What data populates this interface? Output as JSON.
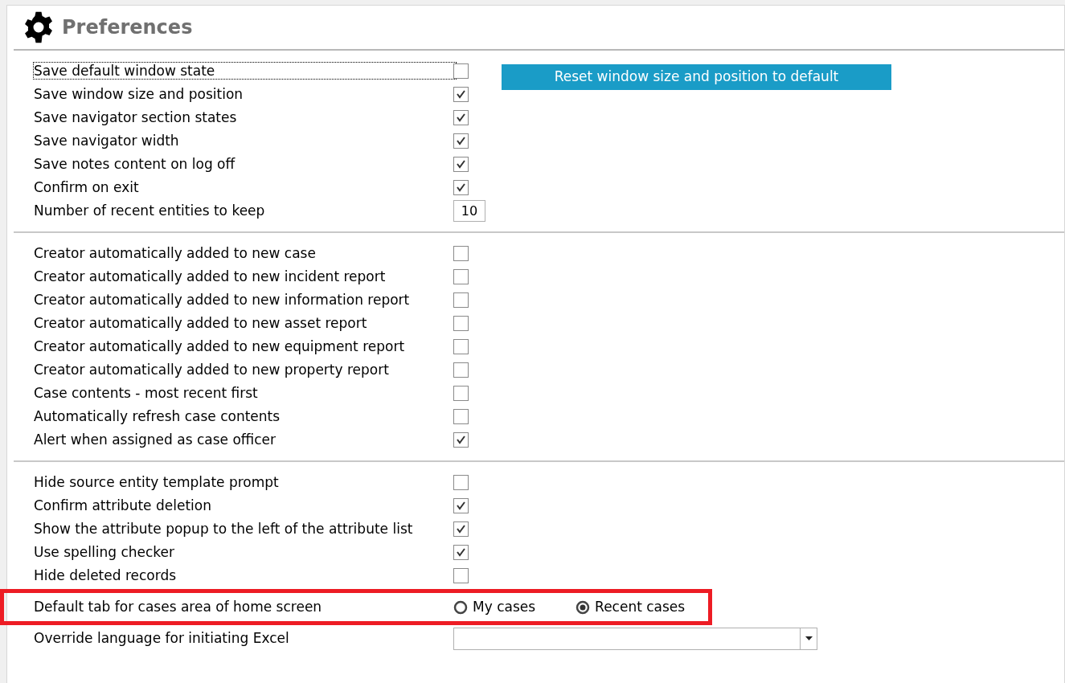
{
  "title": "Preferences",
  "reset_button": "Reset window size and position to default",
  "sections": [
    {
      "items": [
        {
          "kind": "checkbox",
          "label": "Save default window state",
          "checked": false,
          "focused": true
        },
        {
          "kind": "checkbox",
          "label": "Save window size and position",
          "checked": true,
          "focused": false
        },
        {
          "kind": "checkbox",
          "label": "Save navigator section states",
          "checked": true,
          "focused": false
        },
        {
          "kind": "checkbox",
          "label": "Save navigator width",
          "checked": true,
          "focused": false
        },
        {
          "kind": "checkbox",
          "label": "Save notes content on log off",
          "checked": true,
          "focused": false
        },
        {
          "kind": "checkbox",
          "label": "Confirm on exit",
          "checked": true,
          "focused": false
        },
        {
          "kind": "number",
          "label": "Number of recent entities to keep",
          "value": "10",
          "focused": false
        }
      ]
    },
    {
      "items": [
        {
          "kind": "checkbox",
          "label": "Creator automatically added to new case",
          "checked": false
        },
        {
          "kind": "checkbox",
          "label": "Creator automatically added to new incident report",
          "checked": false
        },
        {
          "kind": "checkbox",
          "label": "Creator automatically added to new information report",
          "checked": false
        },
        {
          "kind": "checkbox",
          "label": "Creator automatically added to new asset report",
          "checked": false
        },
        {
          "kind": "checkbox",
          "label": "Creator automatically added to new equipment report",
          "checked": false
        },
        {
          "kind": "checkbox",
          "label": "Creator automatically added to new property report",
          "checked": false
        },
        {
          "kind": "checkbox",
          "label": "Case contents - most recent first",
          "checked": false
        },
        {
          "kind": "checkbox",
          "label": "Automatically refresh case contents",
          "checked": false
        },
        {
          "kind": "checkbox",
          "label": "Alert when assigned as case officer",
          "checked": true
        }
      ]
    },
    {
      "items": [
        {
          "kind": "checkbox",
          "label": "Hide source entity template prompt",
          "checked": false,
          "highlighted": false
        },
        {
          "kind": "checkbox",
          "label": "Confirm attribute deletion",
          "checked": true,
          "highlighted": false
        },
        {
          "kind": "checkbox",
          "label": "Show the attribute popup to the left of the attribute list",
          "checked": true,
          "highlighted": false
        },
        {
          "kind": "checkbox",
          "label": "Use spelling checker",
          "checked": true,
          "highlighted": false
        },
        {
          "kind": "checkbox",
          "label": "Hide deleted records",
          "checked": false,
          "highlighted": false
        },
        {
          "kind": "radio",
          "label": "Default tab for cases area of home screen",
          "highlighted": true,
          "options": [
            {
              "label": "My cases",
              "selected": false
            },
            {
              "label": "Recent cases",
              "selected": true
            }
          ]
        },
        {
          "kind": "select",
          "label": "Override language for initiating Excel",
          "highlighted": false
        }
      ]
    }
  ]
}
